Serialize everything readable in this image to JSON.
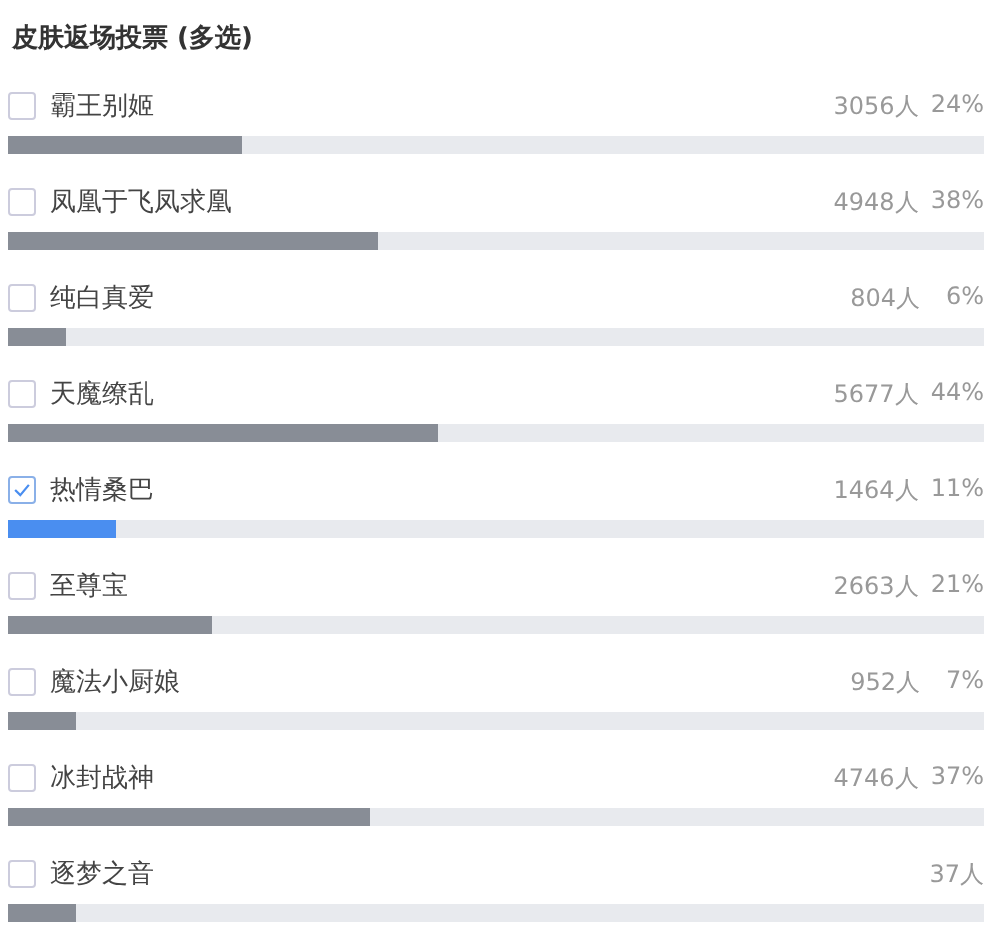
{
  "title": "皮肤返场投票 (多选)",
  "options": [
    {
      "label": "霸王别姬",
      "count": "3056人",
      "percent": "24%",
      "checked": false,
      "level": 0.24
    },
    {
      "label": "凤凰于飞凤求凰",
      "count": "4948人",
      "percent": "38%",
      "checked": false,
      "level": 0.38
    },
    {
      "label": "纯白真爱",
      "count": "804人",
      "percent": "6%",
      "checked": false,
      "level": 0.06
    },
    {
      "label": "天魔缭乱",
      "count": "5677人",
      "percent": "44%",
      "checked": false,
      "level": 0.44
    },
    {
      "label": "热情桑巴",
      "count": "1464人",
      "percent": "11%",
      "checked": true,
      "level": 0.11
    },
    {
      "label": "至尊宝",
      "count": "2663人",
      "percent": "21%",
      "checked": false,
      "level": 0.21
    },
    {
      "label": "魔法小厨娘",
      "count": "952人",
      "percent": "7%",
      "checked": false,
      "level": 0.07
    },
    {
      "label": "冰封战神",
      "count": "4746人",
      "percent": "37%",
      "checked": false,
      "level": 0.37
    },
    {
      "label": "逐梦之音",
      "count": "37人",
      "checked": false,
      "level": 0.07
    }
  ]
}
